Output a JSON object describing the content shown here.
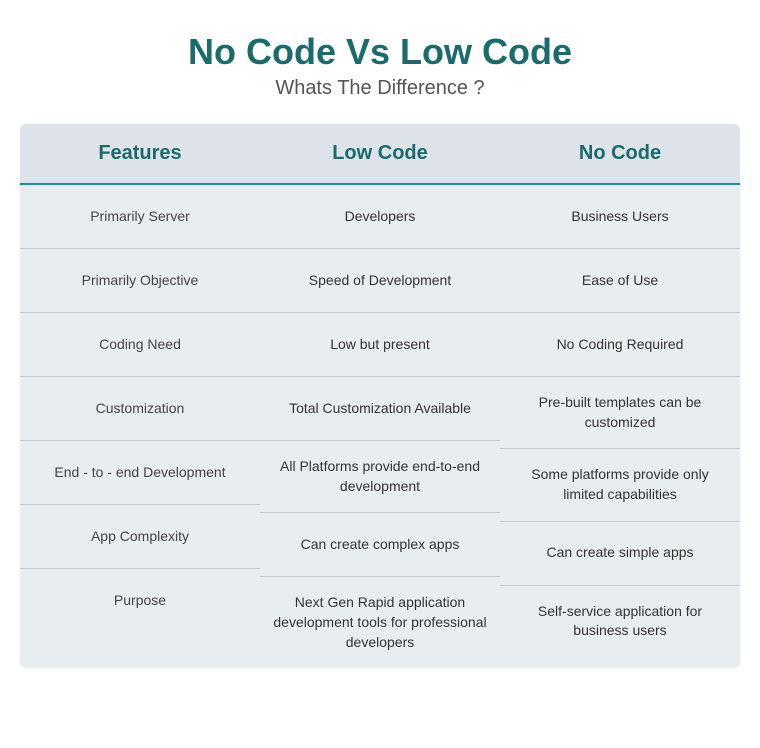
{
  "title": {
    "main": "No Code Vs Low Code",
    "subtitle": "Whats The Difference ?"
  },
  "columns": {
    "features": {
      "header": "Features",
      "rows": [
        "Primarily Server",
        "Primarily Objective",
        "Coding Need",
        "Customization",
        "End - to - end Development",
        "App Complexity",
        "Purpose"
      ]
    },
    "low_code": {
      "header": "Low Code",
      "rows": [
        "Developers",
        "Speed of Development",
        "Low but present",
        "Total Customization Available",
        "All Platforms provide end-to-end development",
        "Can create complex apps",
        "Next Gen Rapid application development tools for professional developers"
      ]
    },
    "no_code": {
      "header": "No Code",
      "rows": [
        "Business Users",
        "Ease of Use",
        "No Coding Required",
        "Pre-built templates can be customized",
        "Some platforms provide only limited capabilities",
        "Can create simple apps",
        "Self-service application for business users"
      ]
    }
  }
}
